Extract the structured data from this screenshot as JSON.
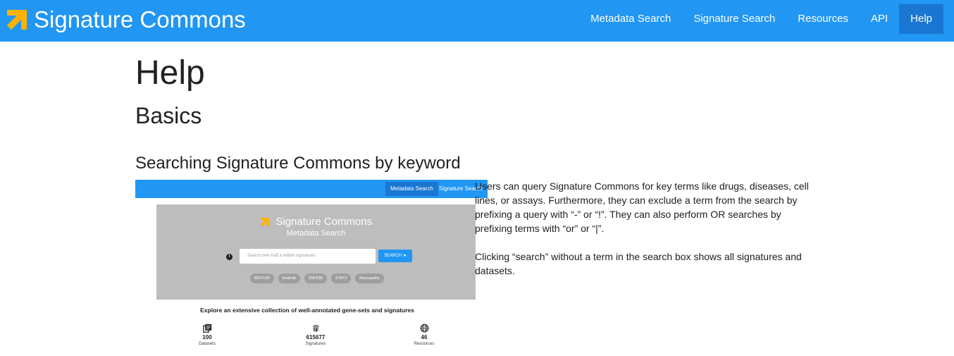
{
  "brand": {
    "name": "Signature Commons",
    "logo_icon": "arrow-up-right-icon",
    "logo_color": "#ffb300"
  },
  "nav": {
    "items": [
      {
        "label": "Metadata Search"
      },
      {
        "label": "Signature Search"
      },
      {
        "label": "Resources"
      },
      {
        "label": "API"
      },
      {
        "label": "Help",
        "active": true
      }
    ]
  },
  "colors": {
    "primary": "#2196f3",
    "primary_dark": "#1976d2",
    "hero_gray": "#bdbdbd"
  },
  "page": {
    "title": "Help",
    "section": "Basics",
    "subsection": "Searching Signature Commons by keyword",
    "paragraphs": [
      "Users can query Signature Commons for key terms like drugs, diseases, cell lines, or assays. Furthermore, they can exclude a term from the search by prefixing a query with “-” or “!”. They can also perform OR searches by prefixing terms with “or” or “|”.",
      "Clicking “search” without a term in the search box shows all signatures and datasets."
    ]
  },
  "screenshot": {
    "nav": [
      "Metadata Search",
      "Signature Search"
    ],
    "brand": "Signature Commons",
    "subtitle": "Metadata Search",
    "search_placeholder": "Search over half a million signatures",
    "search_button": "SEARCH ➤",
    "chips": [
      "MCF10A",
      "Imatinib",
      "ZNF830",
      "STAT3",
      "Neuropathy"
    ],
    "explore_text": "Explore an extensive collection of well-annotated gene-sets and signatures",
    "stats": [
      {
        "value": "100",
        "label": "Datasets",
        "icon": "library-icon"
      },
      {
        "value": "615677",
        "label": "Signatures",
        "icon": "fingerprint-icon"
      },
      {
        "value": "46",
        "label": "Resources",
        "icon": "globe-icon"
      }
    ]
  }
}
